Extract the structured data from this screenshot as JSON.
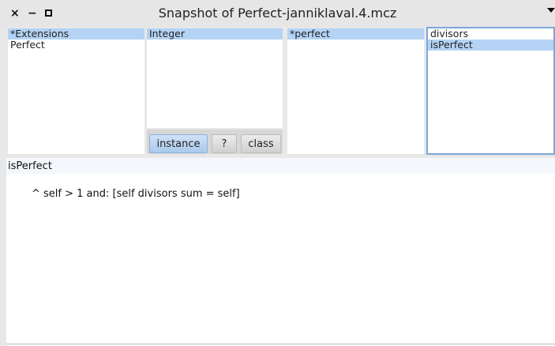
{
  "window": {
    "title": "Snapshot of Perfect-janniklaval.4.mcz",
    "close_glyph": "×",
    "minimize_glyph": "−"
  },
  "packages": {
    "items": [
      {
        "label": "*Extensions",
        "selected": true
      },
      {
        "label": "Perfect",
        "selected": false
      }
    ]
  },
  "classes": {
    "items": [
      {
        "label": "Integer",
        "selected": true
      }
    ],
    "buttons": {
      "instance": "instance",
      "comment": "?",
      "class": "class"
    }
  },
  "protocols": {
    "items": [
      {
        "label": "*perfect",
        "selected": true
      }
    ]
  },
  "methods": {
    "items": [
      {
        "label": "divisors",
        "selected": false
      },
      {
        "label": "isPerfect",
        "selected": true
      }
    ]
  },
  "code": {
    "signature": "isPerfect",
    "body": "^ self > 1 and: [self divisors sum = self]"
  },
  "colors": {
    "selection": "#b4d3f5",
    "focus_border": "#7aa8d8"
  }
}
